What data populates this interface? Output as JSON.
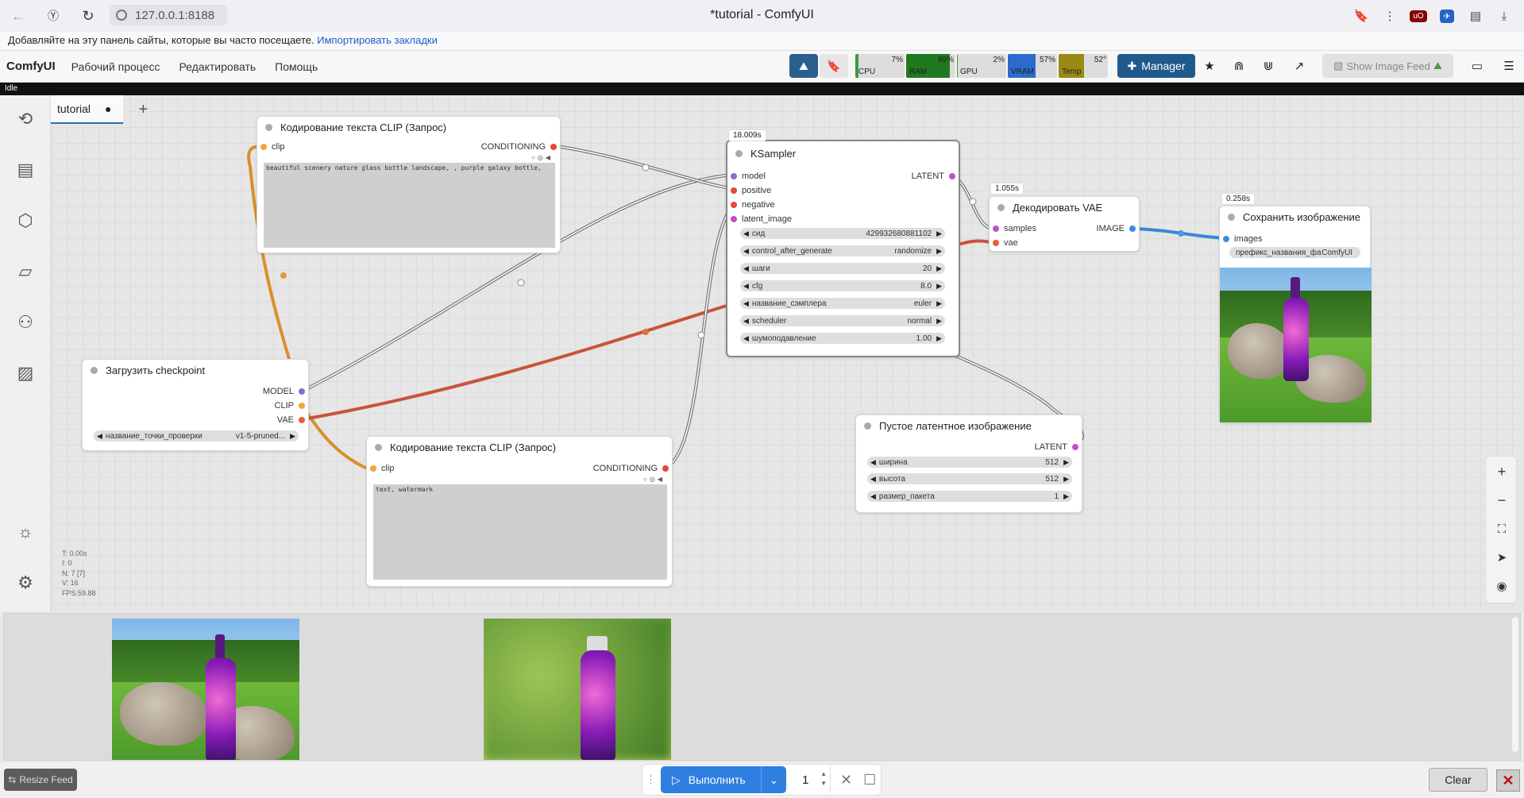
{
  "browser": {
    "url": "127.0.0.1:8188",
    "title": "*tutorial - ComfyUI",
    "bookmark_prompt": "Добавляйте на эту панель сайты, которые вы часто посещаете.",
    "bookmark_link": "Импортировать закладки"
  },
  "menu": {
    "logo": "ComfyUI",
    "items": [
      "Рабочий процесс",
      "Редактировать",
      "Помощь"
    ],
    "status": "Idle",
    "monitors": [
      {
        "label": "CPU",
        "value": "7%",
        "level": 0.07,
        "color": "#3a9a3a"
      },
      {
        "label": "RAM",
        "value": "89%",
        "level": 0.89,
        "color": "#1f7a1f"
      },
      {
        "label": "GPU",
        "value": "2%",
        "level": 0.02,
        "color": "#3a9a3a"
      },
      {
        "label": "VRAM",
        "value": "57%",
        "level": 0.57,
        "color": "#2c6bc9"
      },
      {
        "label": "Temp",
        "value": "52°",
        "level": 0.52,
        "color": "#9a8a14"
      }
    ],
    "manager_label": "Manager",
    "show_feed_label": "Show Image Feed"
  },
  "tabs": [
    {
      "label": "tutorial",
      "modified": "●"
    }
  ],
  "nodes": {
    "clip_pos": {
      "title": "Кодирование текста CLIP (Запрос)",
      "input": "clip",
      "output": "CONDITIONING",
      "text": "beautiful scenery nature glass bottle landscape, , purple galaxy bottle,"
    },
    "clip_neg": {
      "title": "Кодирование текста CLIP (Запрос)",
      "input": "clip",
      "output": "CONDITIONING",
      "text": "text, watermark"
    },
    "checkpoint": {
      "title": "Загрузить checkpoint",
      "outputs": [
        "MODEL",
        "CLIP",
        "VAE"
      ],
      "widget_name": "название_точки_проверки",
      "widget_value": "v1-5-pruned..."
    },
    "ksampler": {
      "title": "KSampler",
      "exec_time": "18.009s",
      "inputs": [
        "model",
        "positive",
        "negative",
        "latent_image"
      ],
      "output": "LATENT",
      "widgets": [
        {
          "name": "сид",
          "value": "429932680881102"
        },
        {
          "name": "control_after_generate",
          "value": "randomize"
        },
        {
          "name": "шаги",
          "value": "20"
        },
        {
          "name": "cfg",
          "value": "8.0"
        },
        {
          "name": "название_сэмплера",
          "value": "euler"
        },
        {
          "name": "scheduler",
          "value": "normal"
        },
        {
          "name": "шумоподавление",
          "value": "1.00"
        }
      ]
    },
    "vae_decode": {
      "title": "Декодировать VAE",
      "exec_time": "1.055s",
      "inputs": [
        "samples",
        "vae"
      ],
      "output": "IMAGE"
    },
    "save_image": {
      "title": "Сохранить изображение",
      "exec_time": "0.258s",
      "input": "images",
      "widget_name": "префикс_названия_файла",
      "widget_value": "ComfyUI"
    },
    "empty_latent": {
      "title": "Пустое латентное изображение",
      "output": "LATENT",
      "widgets": [
        {
          "name": "ширина",
          "value": "512"
        },
        {
          "name": "высота",
          "value": "512"
        },
        {
          "name": "размер_пакета",
          "value": "1"
        }
      ]
    }
  },
  "stats": [
    "T: 0.00s",
    "I: 0",
    "N: 7 [7]",
    "V: 16",
    "FPS:59.88"
  ],
  "bottom": {
    "resize_feed": "Resize Feed",
    "run_label": "Выполнить",
    "batch_count": "1",
    "clear_label": "Clear"
  }
}
